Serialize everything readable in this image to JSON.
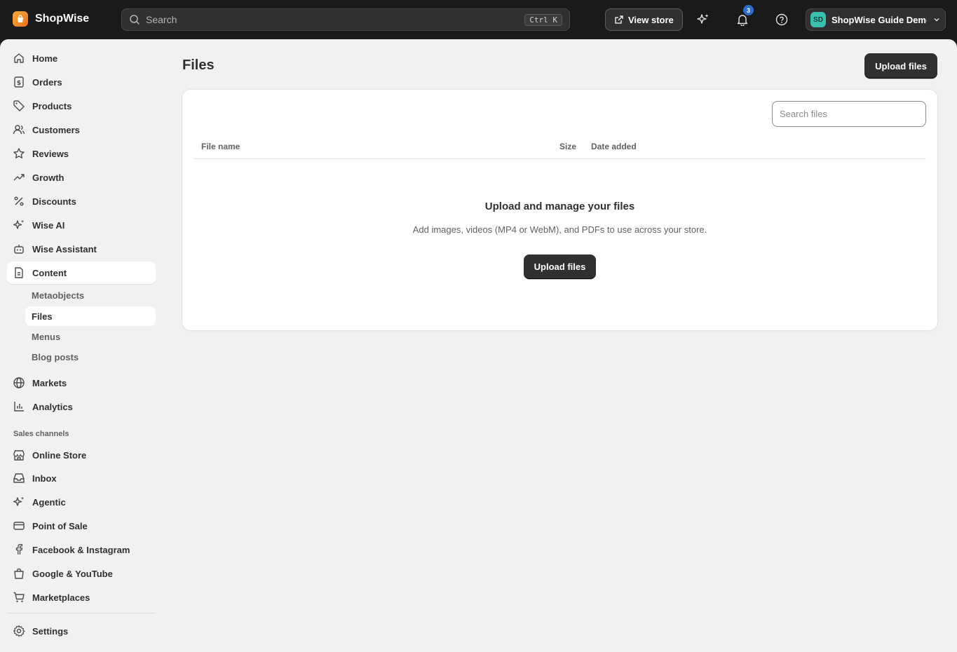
{
  "topbar": {
    "brand": "ShopWise",
    "search_placeholder": "Search",
    "search_shortcut": "Ctrl K",
    "view_store": "View store",
    "notification_count": "3",
    "account_initials": "SD",
    "account_name": "ShopWise Guide Demo"
  },
  "sidebar": {
    "items": [
      {
        "label": "Home",
        "icon": "home-icon"
      },
      {
        "label": "Orders",
        "icon": "orders-icon"
      },
      {
        "label": "Products",
        "icon": "tag-icon"
      },
      {
        "label": "Customers",
        "icon": "people-icon"
      },
      {
        "label": "Reviews",
        "icon": "star-icon"
      },
      {
        "label": "Growth",
        "icon": "trend-icon"
      },
      {
        "label": "Discounts",
        "icon": "percent-icon"
      },
      {
        "label": "Wise AI",
        "icon": "sparkle-icon"
      },
      {
        "label": "Wise Assistant",
        "icon": "robot-icon"
      },
      {
        "label": "Content",
        "icon": "document-icon"
      }
    ],
    "content_sub": [
      "Metaobjects",
      "Files",
      "Menus",
      "Blog posts"
    ],
    "items2": [
      {
        "label": "Markets",
        "icon": "globe-icon"
      },
      {
        "label": "Analytics",
        "icon": "chart-icon"
      }
    ],
    "sales_channels_label": "Sales channels",
    "channels": [
      {
        "label": "Online Store",
        "icon": "store-icon"
      },
      {
        "label": "Inbox",
        "icon": "inbox-icon"
      },
      {
        "label": "Agentic",
        "icon": "sparkle-icon"
      },
      {
        "label": "Point of Sale",
        "icon": "card-icon"
      },
      {
        "label": "Facebook & Instagram",
        "icon": "facebook-icon"
      },
      {
        "label": "Google & YouTube",
        "icon": "bag-icon"
      },
      {
        "label": "Marketplaces",
        "icon": "cart-icon"
      }
    ],
    "settings": "Settings"
  },
  "page": {
    "title": "Files",
    "upload_button": "Upload files",
    "search_placeholder": "Search files",
    "columns": [
      "File name",
      "Size",
      "Date added"
    ],
    "empty_title": "Upload and manage your files",
    "empty_desc": "Add images, videos (MP4 or WebM), and PDFs to use across your store.",
    "empty_button": "Upload files"
  }
}
